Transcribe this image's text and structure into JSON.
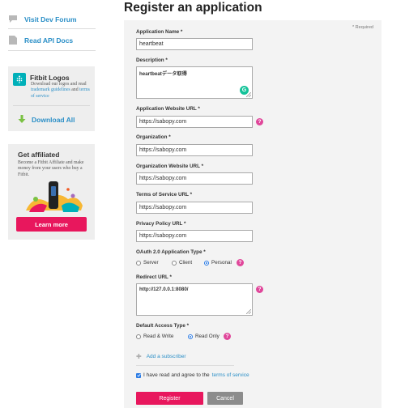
{
  "sidebar": {
    "links": [
      {
        "label": "Visit Dev Forum",
        "icon": "chat-bubble-icon"
      },
      {
        "label": "Read API Docs",
        "icon": "document-icon"
      }
    ],
    "logos_box": {
      "title": "Fitbit Logos",
      "desc_prefix": "Download our logos and read",
      "link1": "trademark guidelines",
      "desc_mid": "and",
      "link2": "terms of service",
      "download_label": "Download All"
    },
    "affiliate_box": {
      "title": "Get affiliated",
      "desc": "Become a Fitbit Affiliate and make money from your users who buy a Fitbit.",
      "button_label": "Learn more"
    }
  },
  "main": {
    "title": "Register an application",
    "required_note": "* Required",
    "fields": {
      "app_name": {
        "label": "Application Name *",
        "value": "heartbeat"
      },
      "description": {
        "label": "Description *",
        "value": "heartbeatデータ取得"
      },
      "website_url": {
        "label": "Application Website URL *",
        "value": "https://sabopy.com"
      },
      "organization": {
        "label": "Organization *",
        "value": "https://sabopy.com"
      },
      "org_website_url": {
        "label": "Organization Website URL *",
        "value": "https://sabopy.com"
      },
      "tos_url": {
        "label": "Terms of Service URL *",
        "value": "https://sabopy.com"
      },
      "privacy_url": {
        "label": "Privacy Policy URL *",
        "value": "https://sabopy.com"
      },
      "redirect_url": {
        "label": "Redirect URL *",
        "value": "http://127.0.0.1:8080/"
      }
    },
    "oauth_type": {
      "label": "OAuth 2.0 Application Type *",
      "options": [
        "Server",
        "Client",
        "Personal"
      ],
      "selected": "Personal"
    },
    "access_type": {
      "label": "Default Access Type *",
      "options": [
        "Read & Write",
        "Read Only"
      ],
      "selected": "Read Only"
    },
    "help_glyph": "?",
    "grammarly_glyph": "G",
    "add_subscriber": "Add a subscriber",
    "agree_text": "I have read and agree to the",
    "agree_link": "terms of service",
    "register_label": "Register",
    "cancel_label": "Cancel"
  },
  "colors": {
    "accent_pink": "#e8175d",
    "link_blue": "#2b8fc7",
    "help_magenta": "#e0469a",
    "teal": "#00b0b9"
  }
}
